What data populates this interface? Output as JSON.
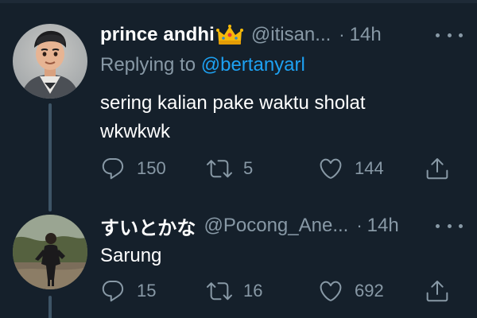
{
  "tweets": [
    {
      "display_name": "prince andhi",
      "has_crown_emoji": true,
      "handle": "@itisan...",
      "separator": "·",
      "time": "14h",
      "replying_prefix": "Replying to ",
      "replying_to": "@bertanyarl",
      "text_line1": "sering kalian pake waktu sholat",
      "text_line2": "wkwkwk",
      "reply_count": "150",
      "retweet_count": "5",
      "like_count": "144",
      "avatar": "cartoon-character-avatar"
    },
    {
      "display_name": "すいとかな",
      "handle": "@Pocong_Ane...",
      "separator": "·",
      "time": "14h",
      "text_line1": "Sarung",
      "reply_count": "15",
      "retweet_count": "16",
      "like_count": "692",
      "avatar": "person-outdoor-photo-avatar"
    }
  ],
  "colors": {
    "background": "#15202b",
    "primary_text": "#ffffff",
    "secondary_text": "#8899a6",
    "link": "#1da1f2",
    "thread_line": "#3d5466"
  },
  "icons": [
    "reply-icon",
    "retweet-icon",
    "like-icon",
    "share-icon",
    "more-icon",
    "crown-emoji"
  ]
}
